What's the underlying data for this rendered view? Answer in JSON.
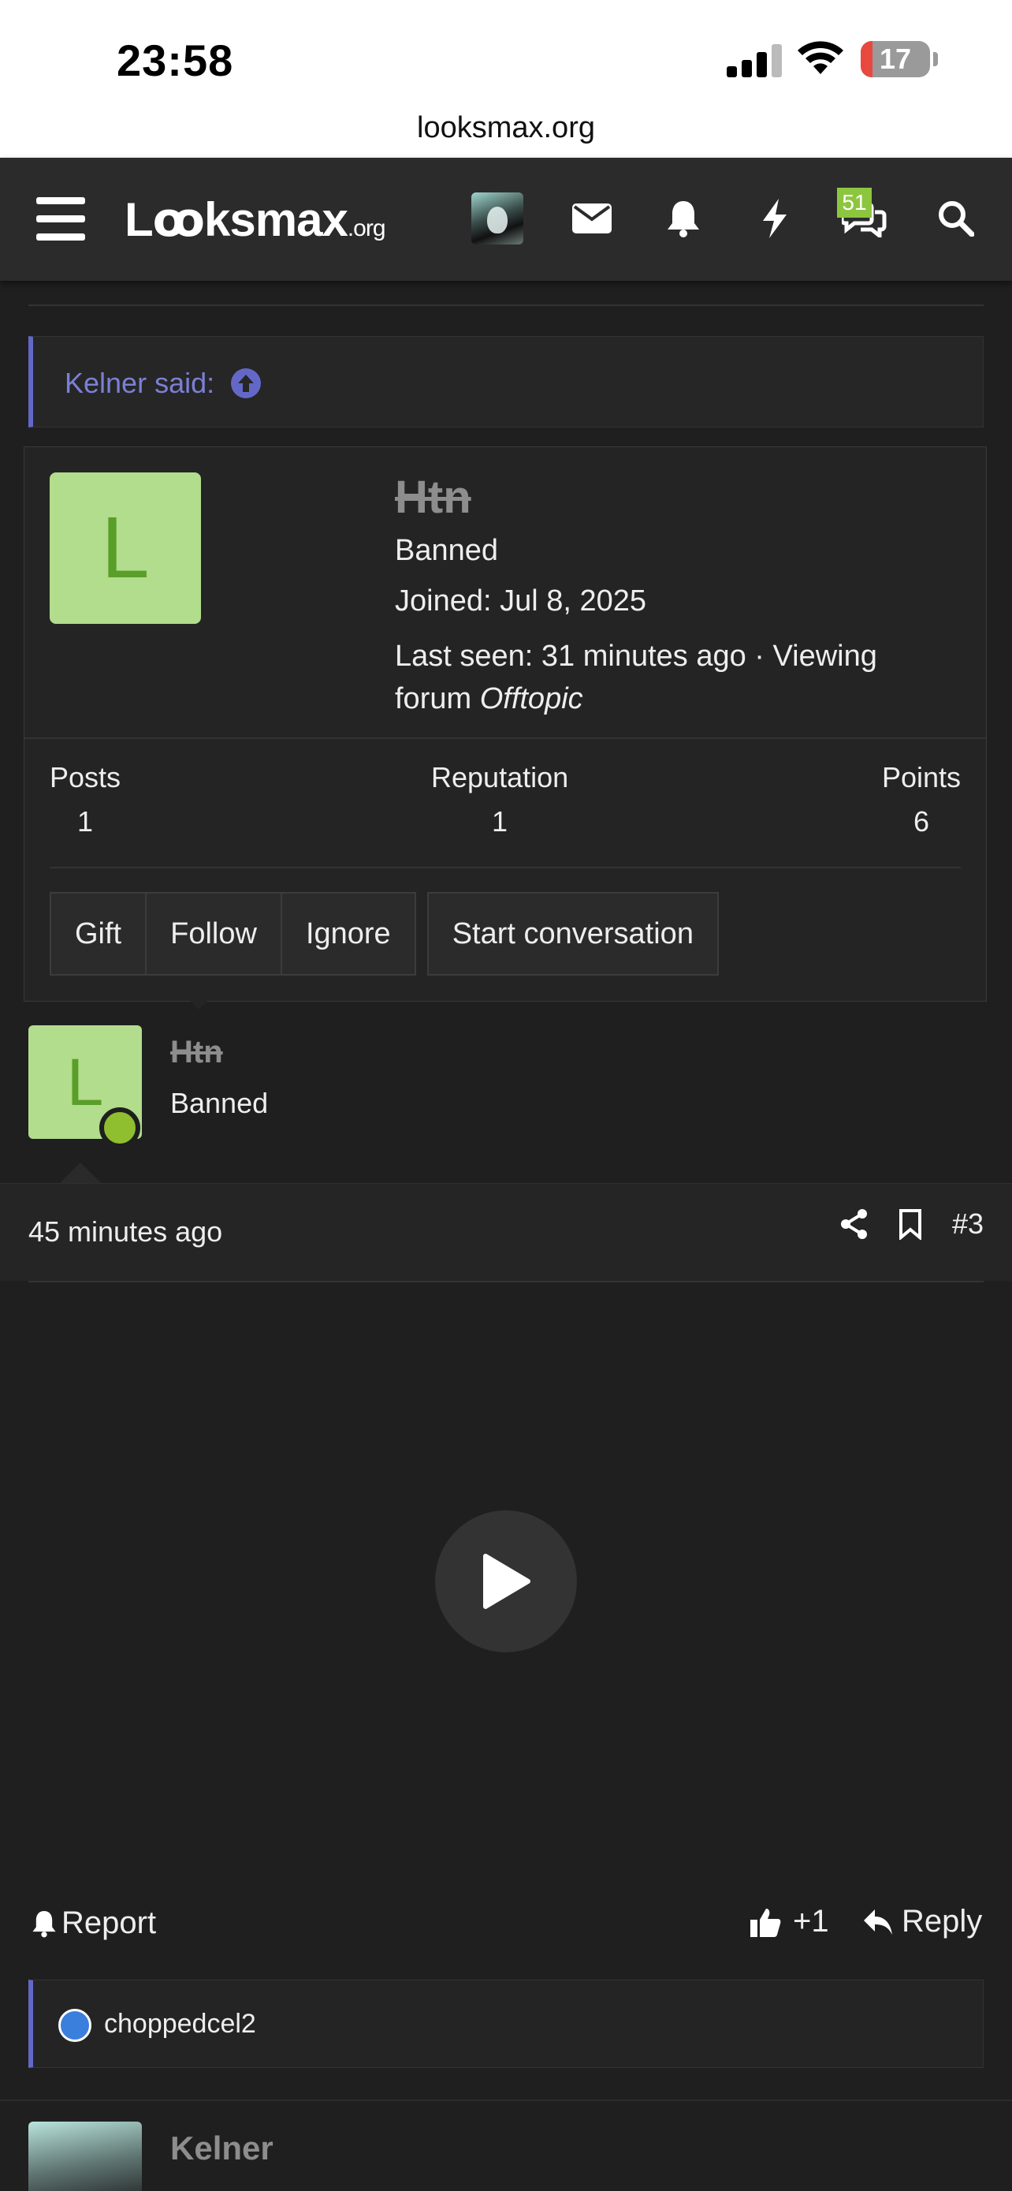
{
  "status_bar": {
    "time": "23:58",
    "battery": "17",
    "battery_level": 0.17
  },
  "browser": {
    "url": "looksmax.org"
  },
  "header": {
    "logo_main": "Lꝏksmax",
    "logo_suffix": ".org",
    "messages_badge": "51",
    "icons": [
      "menu-icon",
      "user-avatar",
      "envelope-icon",
      "bell-icon",
      "bolt-icon",
      "conversations-icon",
      "search-icon"
    ]
  },
  "quote": {
    "author_label": "Kelner said:"
  },
  "member_card": {
    "avatar_letter": "L",
    "name": "Htn",
    "user_title": "Banned",
    "joined": "Joined: Jul 8, 2025",
    "last_seen_prefix": "Last seen: 31 minutes ago · Viewing forum ",
    "last_seen_forum": "Offtopic",
    "stats": {
      "posts_label": "Posts",
      "posts_value": "1",
      "reputation_label": "Reputation",
      "reputation_value": "1",
      "points_label": "Points",
      "points_value": "6"
    },
    "buttons": {
      "gift": "Gift",
      "follow": "Follow",
      "ignore": "Ignore",
      "start_conversation": "Start conversation"
    }
  },
  "post": {
    "avatar_letter": "L",
    "username": "Htn",
    "user_title": "Banned",
    "time": "45 minutes ago",
    "post_number": "#3",
    "report_label": "Report",
    "like_count": "+1",
    "reply_label": "Reply",
    "reactions_user": "choppedcel2"
  },
  "next_post": {
    "username": "Kelner"
  },
  "colors": {
    "accent": "#6368c8",
    "avatar_bg": "#b1dd8c",
    "online": "#8fbf2e",
    "badge": "#8cc63f"
  }
}
